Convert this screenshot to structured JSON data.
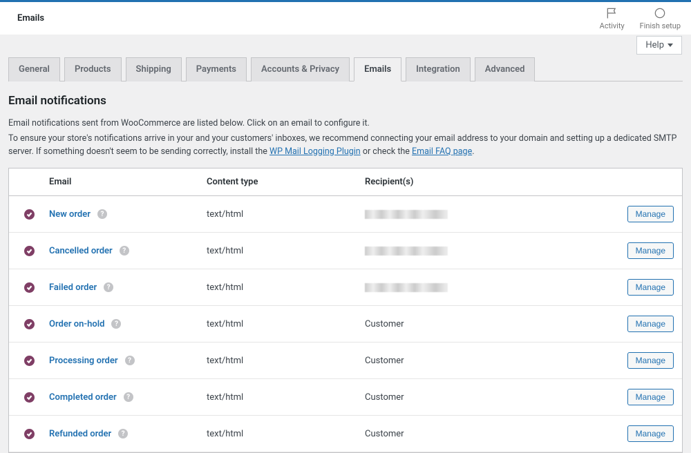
{
  "topbar": {
    "title": "Emails",
    "activity": "Activity",
    "finshSetup": "Finish setup"
  },
  "help": "Help",
  "tabs": [
    {
      "label": "General",
      "active": false
    },
    {
      "label": "Products",
      "active": false
    },
    {
      "label": "Shipping",
      "active": false
    },
    {
      "label": "Payments",
      "active": false
    },
    {
      "label": "Accounts & Privacy",
      "active": false
    },
    {
      "label": "Emails",
      "active": true
    },
    {
      "label": "Integration",
      "active": false
    },
    {
      "label": "Advanced",
      "active": false
    }
  ],
  "section": {
    "title": "Email notifications",
    "desc1": "Email notifications sent from WooCommerce are listed below. Click on an email to configure it.",
    "desc2_pre": "To ensure your store's notifications arrive in your and your customers' inboxes, we recommend connecting your email address to your domain and setting up a dedicated SMTP server. If something doesn't seem to be sending correctly, install the ",
    "link1": "WP Mail Logging Plugin",
    "desc2_mid": " or check the ",
    "link2": "Email FAQ page",
    "desc2_end": "."
  },
  "tableHeaders": {
    "email": "Email",
    "contentType": "Content type",
    "recipients": "Recipient(s)"
  },
  "manageLabel": "Manage",
  "rows": [
    {
      "name": "New order",
      "contentType": "text/html",
      "recipient": "",
      "blurred": true
    },
    {
      "name": "Cancelled order",
      "contentType": "text/html",
      "recipient": "",
      "blurred": true
    },
    {
      "name": "Failed order",
      "contentType": "text/html",
      "recipient": "",
      "blurred": true
    },
    {
      "name": "Order on-hold",
      "contentType": "text/html",
      "recipient": "Customer",
      "blurred": false
    },
    {
      "name": "Processing order",
      "contentType": "text/html",
      "recipient": "Customer",
      "blurred": false
    },
    {
      "name": "Completed order",
      "contentType": "text/html",
      "recipient": "Customer",
      "blurred": false
    },
    {
      "name": "Refunded order",
      "contentType": "text/html",
      "recipient": "Customer",
      "blurred": false
    }
  ]
}
